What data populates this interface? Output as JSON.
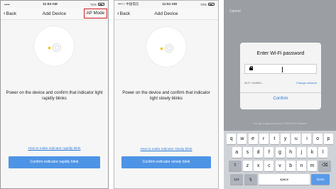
{
  "panels": [
    {
      "status": {
        "carrier": "•••••",
        "wifi": "ᯤ",
        "time": "11:53 AM",
        "battery": "71%"
      },
      "back_label": "Back",
      "title": "Add Device",
      "ap_mode_label": "AP Mode",
      "message": "Power on the device and confirm that indicator light rapidly blinks",
      "help_link": "How to make indicator rapidly blink",
      "confirm_label": "Confirm indicator rapidly blink"
    },
    {
      "status": {
        "carrier": "•••○○ 中国电信",
        "wifi": "ᯤ",
        "time": "11:51 AM",
        "battery": "72%"
      },
      "back_label": "Back",
      "title": "Add Device",
      "message": "Power on the device and confirm that indicator light slowly blinks",
      "help_link": "How to make indicator slowly blink",
      "confirm_label": "Confirm indicator slowly blink"
    }
  ],
  "dialog": {
    "cancel_label": "Cancel",
    "title": "Enter Wi-Fi password",
    "wifi_name": "Wi-Fi : HUAWEI-...",
    "change_network": "Change network",
    "confirm_label": "Confirm",
    "note": "The app is supported only on 2.4GHz Wi-Fi channels"
  },
  "keyboard": {
    "row1": [
      "q",
      "w",
      "e",
      "r",
      "t",
      "y",
      "u",
      "i",
      "o",
      "p"
    ],
    "row2": [
      "a",
      "s",
      "d",
      "f",
      "g",
      "h",
      "j",
      "k",
      "l"
    ],
    "row3": [
      "z",
      "x",
      "c",
      "v",
      "b",
      "n",
      "m"
    ],
    "shift": "⇧",
    "backspace": "⌫",
    "numbers": "123",
    "mic": "🎙",
    "space": "space",
    "done": "Done"
  },
  "colors": {
    "accent": "#4e94e6",
    "link": "#2b78d8",
    "highlight": "#d02020",
    "indicator": "#f5c400"
  }
}
